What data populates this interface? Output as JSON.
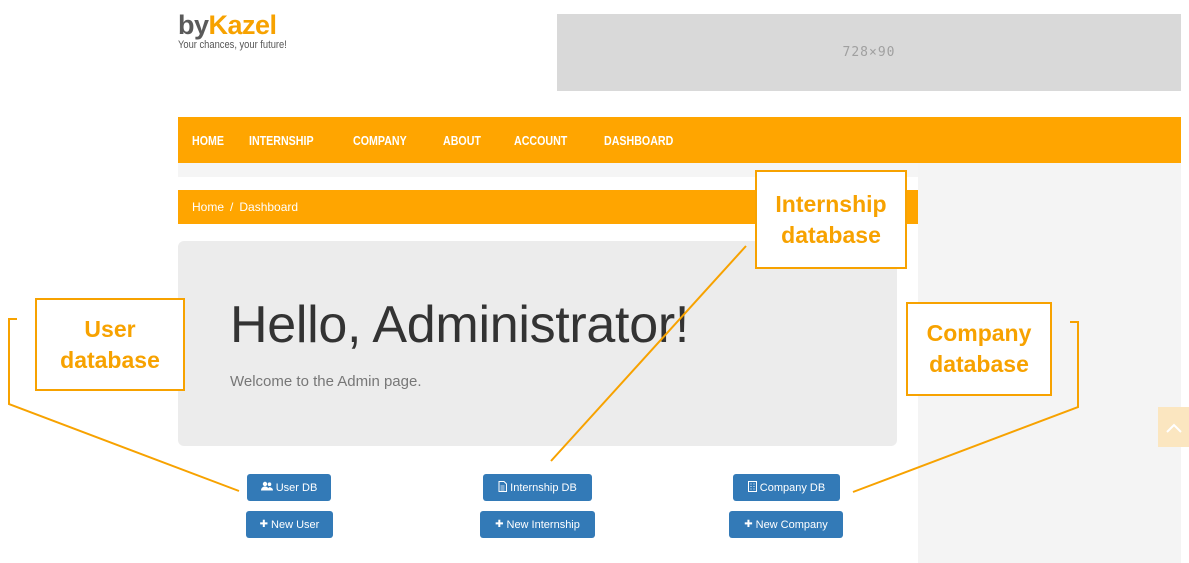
{
  "logo": {
    "by": "by",
    "brand": "Kazel",
    "tagline": "Your chances, your future!"
  },
  "ad": {
    "label": "728×90"
  },
  "nav": {
    "items": [
      "HOME",
      "INTERNSHIP",
      "COMPANY",
      "ABOUT",
      "ACCOUNT",
      "DASHBOARD"
    ]
  },
  "breadcrumb": {
    "home": "Home",
    "separator": "/",
    "current": "Dashboard"
  },
  "hero": {
    "title": "Hello, Administrator!",
    "subtitle": "Welcome to the Admin page."
  },
  "buttons": {
    "user_db": "User DB",
    "new_user": "New User",
    "internship_db": "Internship DB",
    "new_internship": "New Internship",
    "company_db": "Company DB",
    "new_company": "New Company"
  },
  "icons": {
    "user_db": "users-icon",
    "internship_db": "document-icon",
    "company_db": "building-icon",
    "plus": "plus-icon",
    "scroll_top": "chevron-up-icon"
  },
  "annotations": {
    "user": "User database",
    "internship": "Internship database",
    "company": "Company database"
  },
  "colors": {
    "accent": "#ffa500",
    "button": "#337ab7",
    "annotation": "#f7a200"
  }
}
